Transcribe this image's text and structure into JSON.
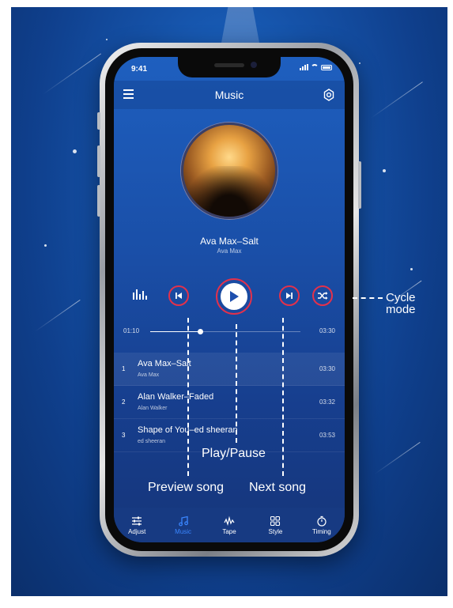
{
  "status": {
    "time": "9:41"
  },
  "appbar": {
    "title": "Music"
  },
  "now_playing": {
    "title": "Ava Max–Salt",
    "artist": "Ava Max"
  },
  "progress": {
    "current": "01:10",
    "total": "03:30",
    "fraction": 0.33
  },
  "playlist": [
    {
      "num": "1",
      "title": "Ava Max–Salt",
      "artist": "Ava Max",
      "duration": "03:30",
      "active": true
    },
    {
      "num": "2",
      "title": "Alan Walker–Faded",
      "artist": "Alan Walker",
      "duration": "03:32",
      "active": false
    },
    {
      "num": "3",
      "title": "Shape of You–ed sheeran",
      "artist": "ed sheeran",
      "duration": "03:53",
      "active": false
    }
  ],
  "tabs": [
    {
      "label": "Adjust",
      "icon": "sliders-icon"
    },
    {
      "label": "Music",
      "icon": "music-note-icon",
      "active": true
    },
    {
      "label": "Tape",
      "icon": "tape-icon"
    },
    {
      "label": "Style",
      "icon": "grid-icon"
    },
    {
      "label": "Timing",
      "icon": "timer-icon"
    }
  ],
  "annotations": {
    "cycle_mode_line1": "Cycle",
    "cycle_mode_line2": "mode",
    "play_pause": "Play/Pause",
    "preview_song": "Preview song",
    "next_song": "Next song"
  },
  "colors": {
    "accent_ring": "#e3314b",
    "active_tab": "#3a86ff",
    "background": "#1552a8"
  }
}
